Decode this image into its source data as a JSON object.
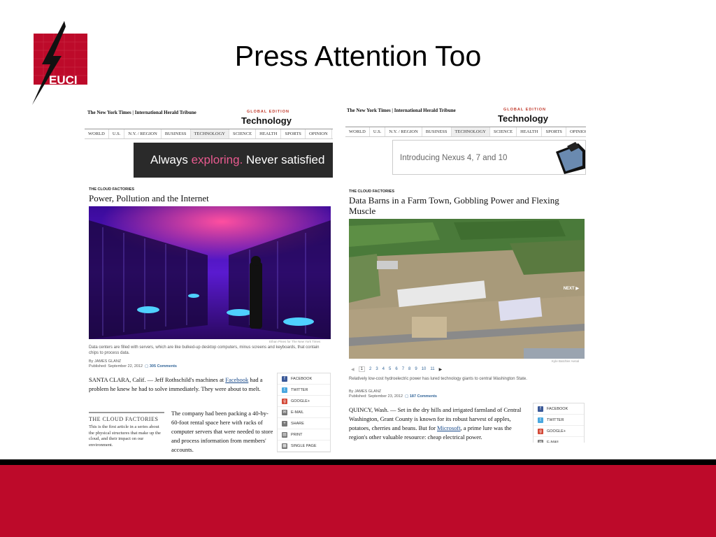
{
  "slide": {
    "title": "Press Attention Too",
    "logo_text": "EUCI",
    "colors": {
      "brand_red": "#bd0a2a",
      "footer_black": "#000000"
    }
  },
  "left_article": {
    "masthead": "The New York Times | International Herald Tribune",
    "edition": "GLOBAL EDITION",
    "section": "Technology",
    "nav": [
      "WORLD",
      "U.S.",
      "N.Y. / REGION",
      "BUSINESS",
      "TECHNOLOGY",
      "SCIENCE",
      "HEALTH",
      "SPORTS",
      "OPINION"
    ],
    "ad": {
      "part1": "Always ",
      "part2": "exploring.",
      "part3": " Never satisfied"
    },
    "kicker": "THE CLOUD FACTORIES",
    "headline": "Power, Pollution and the Internet",
    "photo_credit": "Ethan Pines for The New York Times",
    "caption": "Data centers are filled with servers, which are like bulked-up desktop computers, minus screens and keyboards, that contain chips to process data.",
    "byline": "By JAMES GLANZ",
    "published": "Published: September 22, 2012",
    "comments": "305 Comments",
    "lead": {
      "part1": "SANTA CLARA, Calif. — Jeff Rothschild's machines at ",
      "link": "Facebook",
      "part2": " had a problem he knew he had to solve immediately. They were about to melt."
    },
    "sidebar": {
      "title": "THE CLOUD FACTORIES",
      "text": "This is the first article in a series about the physical structures that make up the cloud, and their impact on our environment."
    },
    "second_para": "The company had been packing a 40-by-60-foot rental space here with racks of computer servers that were needed to store and process information from members' accounts.",
    "share": [
      {
        "label": "FACEBOOK",
        "icon": "facebook-icon",
        "color": "#3b5998",
        "glyph": "f"
      },
      {
        "label": "TWITTER",
        "icon": "twitter-icon",
        "color": "#4aa8e0",
        "glyph": "t"
      },
      {
        "label": "GOOGLE+",
        "icon": "google-plus-icon",
        "color": "#d34836",
        "glyph": "g"
      },
      {
        "label": "E-MAIL",
        "icon": "email-icon",
        "color": "#777777",
        "glyph": "✉"
      },
      {
        "label": "SHARE",
        "icon": "share-icon",
        "color": "#777777",
        "glyph": "+"
      },
      {
        "label": "PRINT",
        "icon": "print-icon",
        "color": "#777777",
        "glyph": "▤"
      },
      {
        "label": "SINGLE PAGE",
        "icon": "single-page-icon",
        "color": "#777777",
        "glyph": "▦"
      }
    ]
  },
  "right_article": {
    "masthead": "The New York Times | International Herald Tribune",
    "edition": "GLOBAL EDITION",
    "section": "Technology",
    "nav": [
      "WORLD",
      "U.S.",
      "N.Y. / REGION",
      "BUSINESS",
      "TECHNOLOGY",
      "SCIENCE",
      "HEALTH",
      "SPORTS",
      "OPINION"
    ],
    "ad": "Introducing Nexus 4, 7 and 10",
    "kicker": "THE CLOUD FACTORIES",
    "headline": "Data Barns in a Farm Town, Gobbling Power and Flexing Muscle",
    "next_label": "NEXT ▶",
    "photo_credit": "Kyle Batchler Aerial",
    "pager": [
      "1",
      "2",
      "3",
      "4",
      "5",
      "6",
      "7",
      "8",
      "9",
      "10",
      "11"
    ],
    "caption": "Relatively low-cost hydroelectric power has lured technology giants to central Washington State.",
    "byline": "By JAMES GLANZ",
    "published": "Published: September 23, 2012",
    "comments": "187 Comments",
    "lead": {
      "part1": "QUINCY, Wash. — Set in the dry hills and irrigated farmland of Central Washington, Grant County is known for its robust harvest of apples, potatoes, cherries and beans. But for ",
      "link": "Microsoft",
      "part2": ", a prime lure was the region's other valuable resource: cheap electrical power."
    },
    "share": [
      {
        "label": "FACEBOOK",
        "icon": "facebook-icon",
        "color": "#3b5998",
        "glyph": "f"
      },
      {
        "label": "TWITTER",
        "icon": "twitter-icon",
        "color": "#4aa8e0",
        "glyph": "t"
      },
      {
        "label": "GOOGLE+",
        "icon": "google-plus-icon",
        "color": "#d34836",
        "glyph": "g"
      },
      {
        "label": "E-MAIL",
        "icon": "email-icon",
        "color": "#777777",
        "glyph": "✉"
      }
    ]
  }
}
